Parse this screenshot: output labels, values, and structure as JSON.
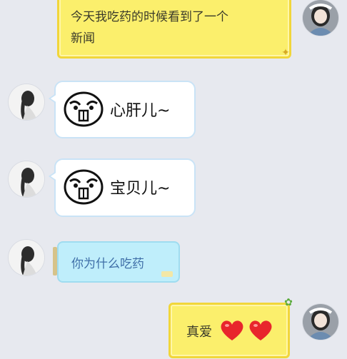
{
  "messages": [
    {
      "sender": "self",
      "text_line1": "今天我吃药的时候看到了一个",
      "text_line2": "新闻"
    },
    {
      "sender": "friend",
      "sticker": "meme-face",
      "text": "心肝儿~"
    },
    {
      "sender": "friend",
      "sticker": "meme-face",
      "text": "宝贝儿~"
    },
    {
      "sender": "friend",
      "text": "你为什么吃药"
    },
    {
      "sender": "self",
      "text": "真爱",
      "hearts": 2
    }
  ],
  "colors": {
    "background": "#e7e9ef",
    "self_bubble": "#fbef6c",
    "friend_bubble_border": "#c9e3f6",
    "blue_bubble": "#bfeefb",
    "heart": "#e8262c"
  }
}
